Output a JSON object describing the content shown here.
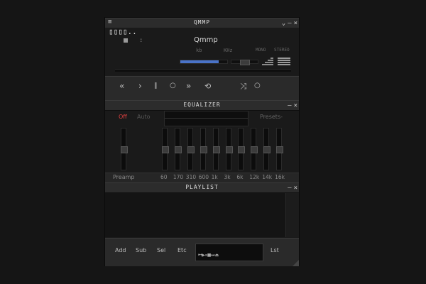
{
  "main_window": {
    "title": "QMMP",
    "menu_icon": "menu-icon",
    "time_display": "▯▯▯▯..",
    "colon": ":",
    "track_title": "Qmmp",
    "kbps_label": "kb",
    "khz_label": "KHz",
    "mono_label": "MONO",
    "stereo_label": "STEREO",
    "volume_level": 0.82
  },
  "window_buttons": {
    "shade": "⌄",
    "minimize": "–",
    "close": "×"
  },
  "controls": {
    "previous_icon": "«",
    "play_icon": "›",
    "pause_icon": "‖",
    "stop_icon": "○",
    "next_icon": "»",
    "eject_icon": "⏏",
    "repeat_icon": "⟲",
    "shuffle_icon": "⤨"
  },
  "equalizer": {
    "title": "EQUALIZER",
    "off_label": "Off",
    "auto_label": "Auto",
    "presets_label": "Presets-",
    "preamp_label": "Preamp",
    "bands": [
      "60",
      "170",
      "310",
      "600",
      "1k",
      "3k",
      "6k",
      "12k",
      "14k",
      "16k"
    ],
    "band_levels": [
      0.5,
      0.5,
      0.5,
      0.5,
      0.5,
      0.5,
      0.5,
      0.5,
      0.5,
      0.5
    ],
    "preamp_level": 0.5
  },
  "playlist": {
    "title": "PLAYLIST",
    "add_label": "Add",
    "sub_label": "Sub",
    "sel_label": "Sel",
    "etc_label": "Etc",
    "lst_label": "Lst",
    "mini_controls": "⏮ ▶ ⏸ ■ ⏭ ⏏"
  }
}
